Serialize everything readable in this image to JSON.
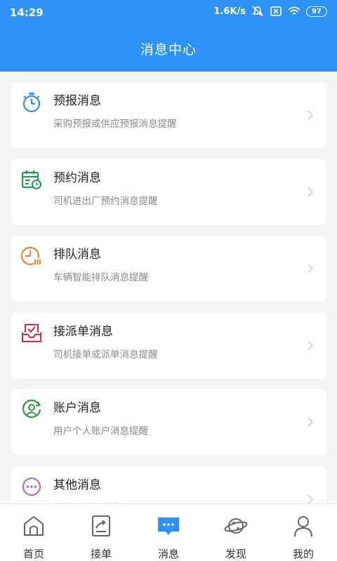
{
  "status": {
    "time": "14:29",
    "network_speed": "1.6K/s",
    "battery": "97"
  },
  "page": {
    "title": "消息中心"
  },
  "messages": [
    {
      "title": "预报消息",
      "desc": "采购预报或供应预报消息提醒",
      "icon": "stopwatch-icon",
      "color": "#2d8fe8"
    },
    {
      "title": "预约消息",
      "desc": "司机进出厂预约消息提醒",
      "icon": "calendar-clock-icon",
      "color": "#1f9a5a"
    },
    {
      "title": "排队消息",
      "desc": "车辆智能排队消息提醒",
      "icon": "queue-clock-icon",
      "color": "#e8862d"
    },
    {
      "title": "接派单消息",
      "desc": "司机接单或派单消息提醒",
      "icon": "inbox-check-icon",
      "color": "#c8324f"
    },
    {
      "title": "账户消息",
      "desc": "用户个人账户消息提醒",
      "icon": "user-circle-icon",
      "color": "#2e9a3a"
    },
    {
      "title": "其他消息",
      "desc": "其他类型消息提醒",
      "icon": "more-dots-icon",
      "color": "#b866d6"
    }
  ],
  "tabs": [
    {
      "label": "首页",
      "icon": "home-icon",
      "active": false
    },
    {
      "label": "接单",
      "icon": "order-icon",
      "active": false
    },
    {
      "label": "消息",
      "icon": "message-icon",
      "active": true
    },
    {
      "label": "发现",
      "icon": "planet-icon",
      "active": false
    },
    {
      "label": "我的",
      "icon": "profile-icon",
      "active": false
    }
  ],
  "colors": {
    "brand": "#2d91f5",
    "tab_active": "#2d91f5"
  }
}
